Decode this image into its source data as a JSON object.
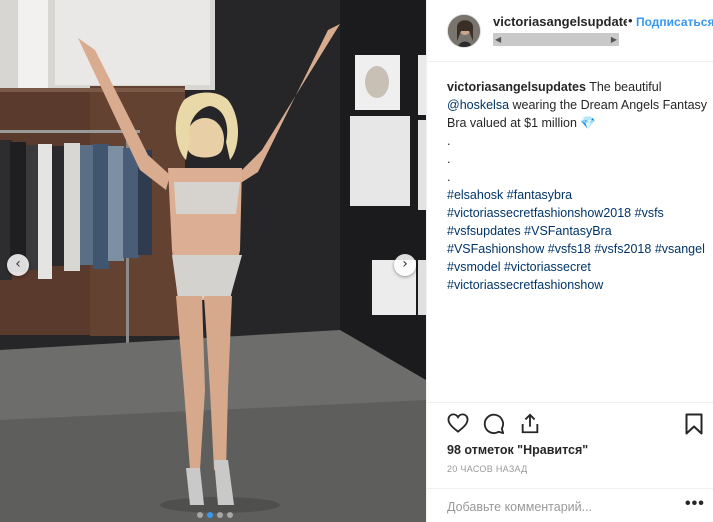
{
  "post": {
    "username": "victoriasangelsupdates",
    "separator": "•",
    "follow_label": "Подписаться",
    "caption": {
      "username": "victoriasangelsupdates",
      "text_before": " The beautiful ",
      "mention": "@hoskelsa",
      "text_after": " wearing the Dream Angels Fantasy Bra valued at $1 million ",
      "emoji": "💎",
      "dots": [
        ".",
        ".",
        "."
      ],
      "hashtags": [
        "#elsahosk",
        "#fantasybra",
        "#victoriassecretfashionshow2018",
        "#vsfs",
        "#vsfsupdates",
        "#VSFantasyBra",
        "#VSFashionshow",
        "#vsfs18",
        "#vsfs2018",
        "#vsangel",
        "#vsmodel",
        "#victoriassecret",
        "#victoriassecretfashionshow"
      ]
    },
    "likes_label": "98 отметок \"Нравится\"",
    "timestamp": "20 ЧАСОВ НАЗАД",
    "comment_placeholder": "Добавьте комментарий...",
    "more_label": "•••",
    "carousel": {
      "slides": 4,
      "active": 1
    },
    "icons": [
      "heart-icon",
      "comment-icon",
      "share-icon",
      "bookmark-icon",
      "chevron-left-icon",
      "chevron-right-icon"
    ],
    "colors": {
      "link": "#003569",
      "follow": "#3897f0",
      "dot_active": "#3897f0"
    }
  }
}
